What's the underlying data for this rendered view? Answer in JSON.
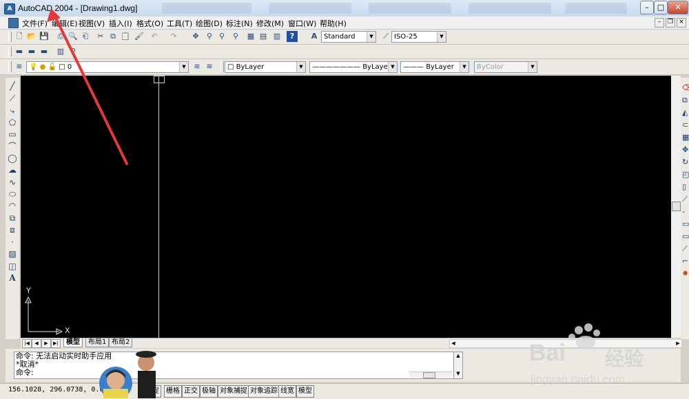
{
  "window": {
    "title": "AutoCAD 2004 - [Drawing1.dwg]",
    "app_icon": "A",
    "buttons": {
      "minimize": "–",
      "maximize": "□",
      "close": "✕"
    }
  },
  "menubar": {
    "items": [
      "文件(F)",
      "编辑(E)",
      "视图(V)",
      "插入(I)",
      "格式(O)",
      "工具(T)",
      "绘图(D)",
      "标注(N)",
      "修改(M)",
      "窗口(W)",
      "帮助(H)"
    ]
  },
  "toolbar_standard": {
    "text_style": "Standard",
    "dim_style": "ISO-25"
  },
  "layers_toolbar": {
    "current_layer": "0",
    "color": "ByLayer",
    "linetype": "ByLayer",
    "lineweight": "ByLayer",
    "plot_style": "ByColor"
  },
  "canvas": {
    "background": "#000000",
    "ucs_x_label": "X",
    "ucs_y_label": "Y"
  },
  "layout_tabs": [
    "模型",
    "布局1",
    "布局2"
  ],
  "command": {
    "lines": [
      "命令: 无法启动实时助手应用",
      "*取消*"
    ],
    "prompt": "命令:"
  },
  "status": {
    "coords": "156.1028, 296.0738, 0.0000",
    "toggles": [
      "捕捉",
      "栅格",
      "正交",
      "极轴",
      "对象捕捉",
      "对象追踪",
      "线宽",
      "模型"
    ]
  },
  "watermark": {
    "brand": "Bai",
    "brand_cn": "经验",
    "url": "jingyan.baidu.com"
  },
  "annotation_color": "#e03a3a"
}
